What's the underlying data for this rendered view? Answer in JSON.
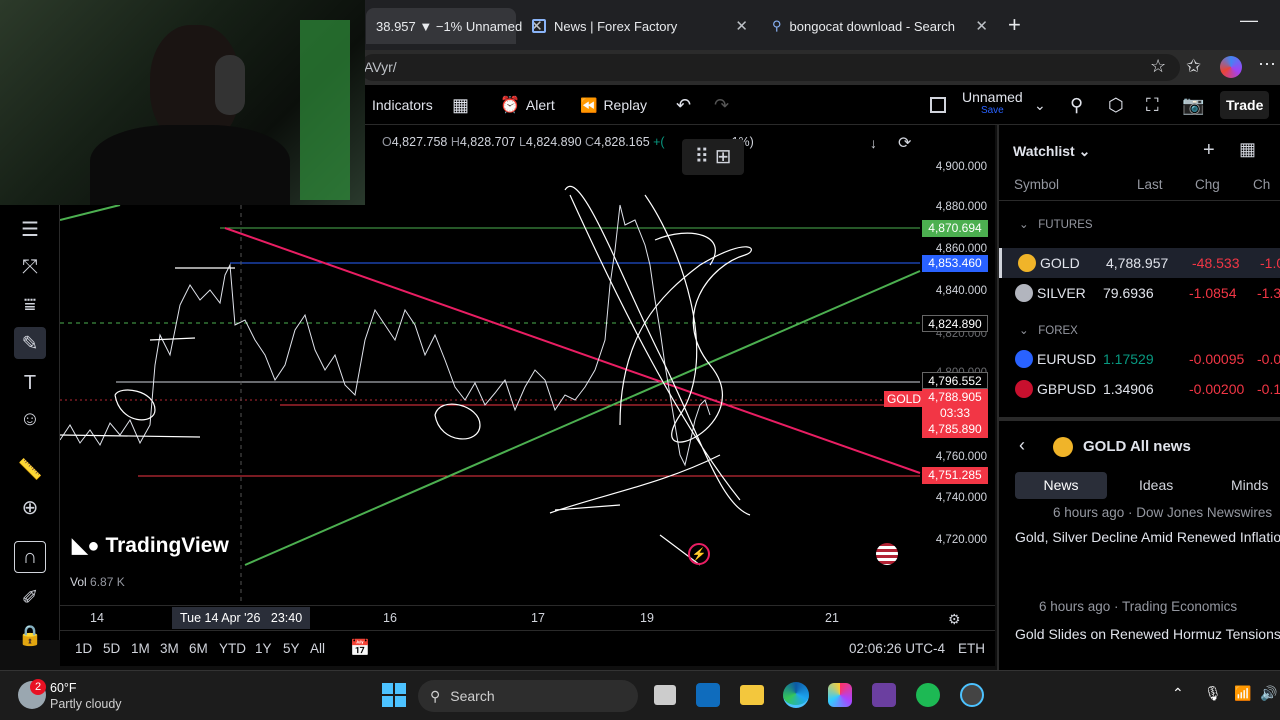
{
  "browser": {
    "tabs": [
      {
        "label": "38.957 ▼ −1% Unnamed"
      },
      {
        "label": "News | Forex Factory"
      },
      {
        "label": "bongocat download - Search"
      }
    ],
    "url": "AVyr/"
  },
  "toolbar": {
    "indicators": "Indicators",
    "alert": "Alert",
    "replay": "Replay",
    "layout_name": "Unnamed",
    "layout_status": "Save",
    "trade": "Trade"
  },
  "chart": {
    "ohlc": {
      "o_label": "O",
      "o": "4,827.758",
      "h_label": "H",
      "h": "4,828.707",
      "l_label": "L",
      "l": "4,824.890",
      "c_label": "C",
      "c": "4,828.165",
      "chg": "+(",
      "chg_tail": "1%)"
    },
    "price_ticks": [
      "4,900.000",
      "4,880.000",
      "4,860.000",
      "4,840.000",
      "4,820.000",
      "4,800.000",
      "4,760.000",
      "4,740.000",
      "4,720.000"
    ],
    "price_tags": [
      {
        "value": "4,870.694",
        "color": "#4caf50"
      },
      {
        "value": "4,853.460",
        "color": "#2962ff"
      },
      {
        "value": "4,824.890",
        "color": "#000000"
      },
      {
        "value": "4,796.552",
        "color": "#000000"
      },
      {
        "value": "4,788.905",
        "color": "#f23645"
      },
      {
        "value": "03:33",
        "color": "#f23645"
      },
      {
        "value": "4,785.890",
        "color": "#f23645"
      },
      {
        "value": "4,751.285",
        "color": "#f23645"
      }
    ],
    "symbol_tag": "GOLD",
    "watermark": "TradingView",
    "volume": {
      "label": "Vol",
      "value": "6.87 K"
    },
    "x_ticks": [
      "14",
      "16",
      "17",
      "19",
      "21"
    ],
    "crosshair_date": "Tue 14 Apr '26   23:40"
  },
  "timeframes": [
    "1D",
    "5D",
    "1M",
    "3M",
    "6M",
    "YTD",
    "1Y",
    "5Y",
    "All"
  ],
  "clock": "02:06:26 UTC-4",
  "session": "ETH",
  "watchlist": {
    "title": "Watchlist",
    "columns": [
      "Symbol",
      "Last",
      "Chg",
      "Ch"
    ],
    "groups": [
      {
        "name": "FUTURES",
        "rows": [
          {
            "symbol": "GOLD",
            "last": "4,788.957",
            "chg": "-48.533",
            "chp": "-1.0"
          },
          {
            "symbol": "SILVER",
            "last": "79.6936",
            "chg": "-1.0854",
            "chp": "-1.3"
          }
        ]
      },
      {
        "name": "FOREX",
        "rows": [
          {
            "symbol": "EURUSD",
            "last": "1.17529",
            "chg": "-0.00095",
            "chp": "-0.0"
          },
          {
            "symbol": "GBPUSD",
            "last": "1.34906",
            "chg": "-0.00200",
            "chp": "-0.1"
          }
        ]
      }
    ]
  },
  "news": {
    "title": "GOLD All news",
    "tabs": [
      "News",
      "Ideas",
      "Minds"
    ],
    "items": [
      {
        "meta": "6 hours ago · Dow Jones Newswires",
        "headline": "Gold, Silver Decline Amid Renewed Inflatio Concerns — Market Talk"
      },
      {
        "meta": "6 hours ago · Trading Economics",
        "headline": "Gold Slides on Renewed Hormuz Tensions"
      }
    ]
  },
  "taskbar": {
    "weather_temp": "60°F",
    "weather_desc": "Partly cloudy",
    "weather_badge": "2",
    "search": "Search"
  }
}
